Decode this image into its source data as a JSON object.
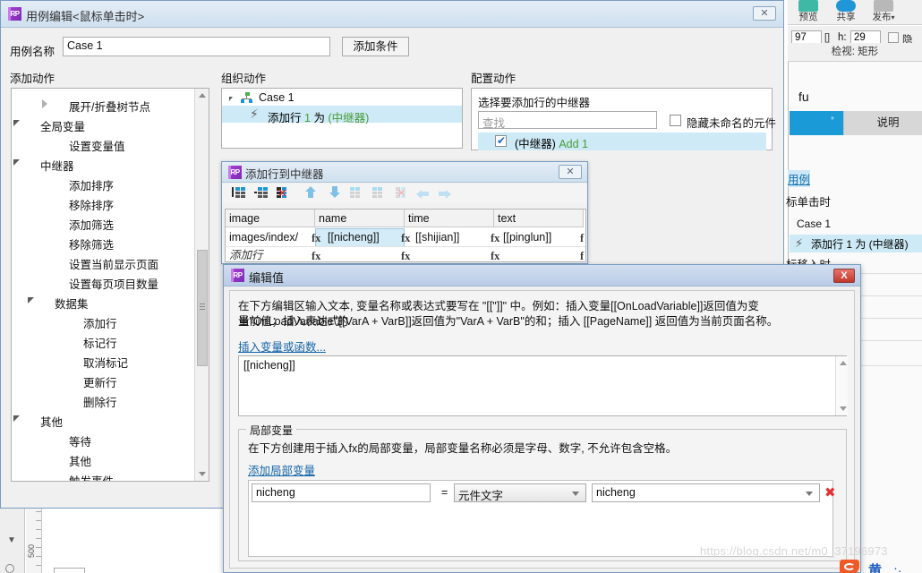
{
  "background": {
    "toolbar": [
      {
        "label": "预览",
        "icon": "preview-icon",
        "color": "#3fb9a5"
      },
      {
        "label": "共享",
        "icon": "share-icon",
        "color": "#2196d6"
      },
      {
        "label": "发布",
        "icon": "publish-icon",
        "color": "#b8b8b8",
        "caret": "▾"
      }
    ],
    "props": {
      "width_value": "97",
      "height_label": "h:",
      "height_value": "29",
      "hidden_label": "隐藏",
      "size_icon": "[]"
    },
    "inspect_label": "检视: 矩形",
    "panel_title": "fu",
    "tabs": [
      {
        "label": "",
        "star": "*",
        "active": true
      },
      {
        "label": "说明",
        "active": false
      }
    ],
    "link_text": "用例",
    "event1": "标单击时",
    "case_label": "Case 1",
    "selected_action": "添加行 1 为 (中继器)",
    "event2": "标移入时"
  },
  "case_window": {
    "title": "用例编辑<鼠标单击时>",
    "app_badge": "RP",
    "close": "✕",
    "name_label": "用例名称",
    "name_value": "Case 1",
    "add_condition": "添加条件",
    "columns": {
      "add_action": "添加动作",
      "organize_action": "组织动作",
      "configure_action": "配置动作"
    },
    "tree": [
      {
        "label": "展开/折叠树节点",
        "indent": 2,
        "marker": "collapsed"
      },
      {
        "label": "全局变量",
        "indent": 0,
        "marker": "expanded"
      },
      {
        "label": "设置变量值",
        "indent": 2,
        "marker": "none"
      },
      {
        "label": "中继器",
        "indent": 0,
        "marker": "expanded"
      },
      {
        "label": "添加排序",
        "indent": 2,
        "marker": "none"
      },
      {
        "label": "移除排序",
        "indent": 2,
        "marker": "none"
      },
      {
        "label": "添加筛选",
        "indent": 2,
        "marker": "none"
      },
      {
        "label": "移除筛选",
        "indent": 2,
        "marker": "none"
      },
      {
        "label": "设置当前显示页面",
        "indent": 2,
        "marker": "none"
      },
      {
        "label": "设置每页项目数量",
        "indent": 2,
        "marker": "none"
      },
      {
        "label": "数据集",
        "indent": 1,
        "marker": "expanded"
      },
      {
        "label": "添加行",
        "indent": 3,
        "marker": "none"
      },
      {
        "label": "标记行",
        "indent": 3,
        "marker": "none"
      },
      {
        "label": "取消标记",
        "indent": 3,
        "marker": "none"
      },
      {
        "label": "更新行",
        "indent": 3,
        "marker": "none"
      },
      {
        "label": "删除行",
        "indent": 3,
        "marker": "none"
      },
      {
        "label": "其他",
        "indent": 0,
        "marker": "expanded"
      },
      {
        "label": "等待",
        "indent": 2,
        "marker": "none"
      },
      {
        "label": "其他",
        "indent": 2,
        "marker": "none"
      },
      {
        "label": "触发事件",
        "indent": 2,
        "marker": "none"
      }
    ],
    "organize": {
      "case_label": "Case 1",
      "action_prefix": "添加行",
      "action_num": "1",
      "action_mid": "为",
      "action_target": "(中继器)"
    },
    "configure": {
      "heading": "选择要添加行的中继器",
      "search_placeholder": "查找",
      "hide_unnamed_label": "隐藏未命名的元件",
      "items": [
        {
          "label_prefix": "(中继器)",
          "label_name": "Add 1",
          "checked": true
        }
      ]
    }
  },
  "repeater_dialog": {
    "title": "添加行到中继器",
    "app_badge": "RP",
    "close": "✕",
    "toolbar_icons": [
      "add-column-before-icon",
      "add-column-after-icon",
      "delete-column-icon",
      "move-up-icon",
      "move-down-icon",
      "add-row-before-icon",
      "add-row-after-icon",
      "delete-row-icon",
      "move-left-icon",
      "move-right-icon"
    ],
    "columns": [
      "image",
      "name",
      "time",
      "text"
    ],
    "rows": [
      {
        "cells": [
          "images/index/",
          "[[nicheng]]",
          "[[shijian]]",
          "[[pinglun]]"
        ],
        "selected_col": 1
      },
      {
        "cells": [
          "添加行",
          "",
          "",
          ""
        ],
        "placeholder": true
      }
    ],
    "fx_label": "fx"
  },
  "edit_value_dialog": {
    "title": "编辑值",
    "app_badge": "RP",
    "close": "X",
    "description_line1": "在下方编辑区输入文本, 变量名称或表达式要写在 \"[[\"]]\" 中。例如：插入变量[[OnLoadVariable]]返回值为变量\"OnLoadVariable\"的",
    "description_line2": "当前值；插入表达式[[VarA + VarB]]返回值为\"VarA + VarB\"的和；插入 [[PageName]] 返回值为当前页面名称。",
    "insert_link": "插入变量或函数...",
    "textarea_value": "[[nicheng]]",
    "local_vars": {
      "group_title": "局部变量",
      "hint": "在下方创建用于插入fx的局部变量，局部变量名称必须是字母、数字, 不允许包含空格。",
      "add_link": "添加局部变量",
      "rows": [
        {
          "name": "nicheng",
          "equals": "=",
          "type": "元件文字",
          "target": "nicheng",
          "delete": "✖"
        }
      ]
    }
  },
  "watermark": {
    "text": "https://blog.csdn.net/m0_37196973"
  },
  "colors": {
    "accent_blue": "#1a9bd7",
    "selection_blue": "#cdeaf6",
    "link_blue": "#1565a8",
    "green_text": "#4a9a3a",
    "purple_badge": "#8e2bbf",
    "red_close": "#c0392b"
  }
}
